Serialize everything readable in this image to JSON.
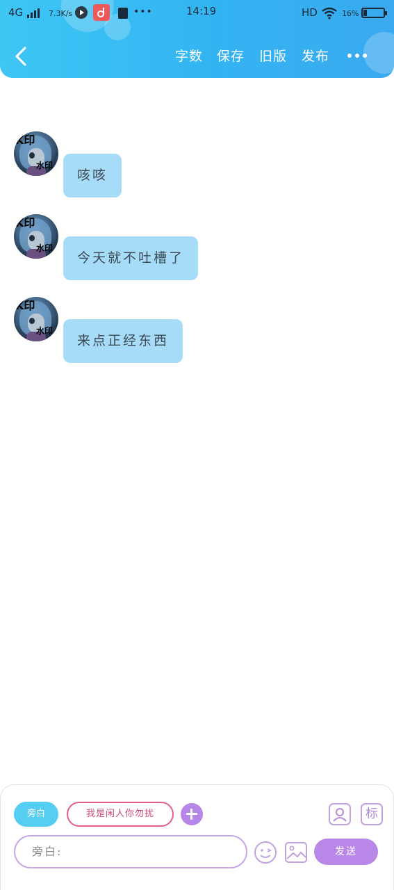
{
  "status_bar": {
    "network": "4G",
    "speed": "7.3K/s",
    "more": "•••",
    "time": "14:19",
    "hd": "HD",
    "battery": "16%"
  },
  "header": {
    "actions": [
      "字数",
      "保存",
      "旧版",
      "发布"
    ]
  },
  "messages": [
    {
      "avatar_watermark_top": "K印",
      "avatar_watermark_bottom": "水印",
      "text": "咳咳"
    },
    {
      "avatar_watermark_top": "K印",
      "avatar_watermark_bottom": "水印",
      "text": "今天就不吐槽了"
    },
    {
      "avatar_watermark_top": "K印",
      "avatar_watermark_bottom": "水印",
      "text": "来点正经东西"
    }
  ],
  "composer": {
    "chip_self": "旁白",
    "chip_role": "我是闲人你勿扰",
    "tag_icon_label": "标",
    "input_value": "旁白:",
    "send_label": "发送"
  },
  "colors": {
    "header_gradient": [
      "#3ec6f4",
      "#3aa9ef"
    ],
    "bubble": "#a6dcf8",
    "accent_purple": "#b887e8",
    "chip_self": "#56cdf3",
    "chip_role_border": "#e25e82"
  },
  "icons": [
    "back-arrow-icon",
    "more-dots-icon",
    "plus-icon",
    "contact-card-icon",
    "tag-icon",
    "emoji-icon",
    "image-icon"
  ]
}
